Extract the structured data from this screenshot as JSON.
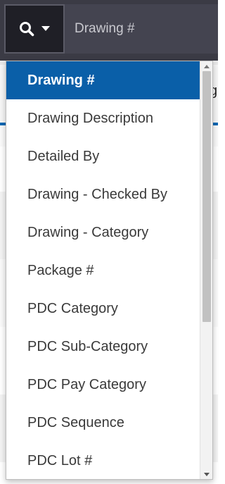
{
  "search": {
    "placeholder": "Drawing #",
    "button_icon": "search-icon",
    "caret_icon": "caret-down-icon"
  },
  "dropdown": {
    "selected_index": 0,
    "items": [
      "Drawing #",
      "Drawing Description",
      "Detailed By",
      "Drawing - Checked By",
      "Drawing - Category",
      "Package #",
      "PDC Category",
      "PDC Sub-Category",
      "PDC Pay Category",
      "PDC Sequence",
      "PDC Lot #"
    ]
  },
  "background": {
    "edge_text": "g"
  },
  "colors": {
    "search_bar": "#3b3b45",
    "selected_item": "#0a5fa8",
    "accent_line": "#0a67b3"
  }
}
